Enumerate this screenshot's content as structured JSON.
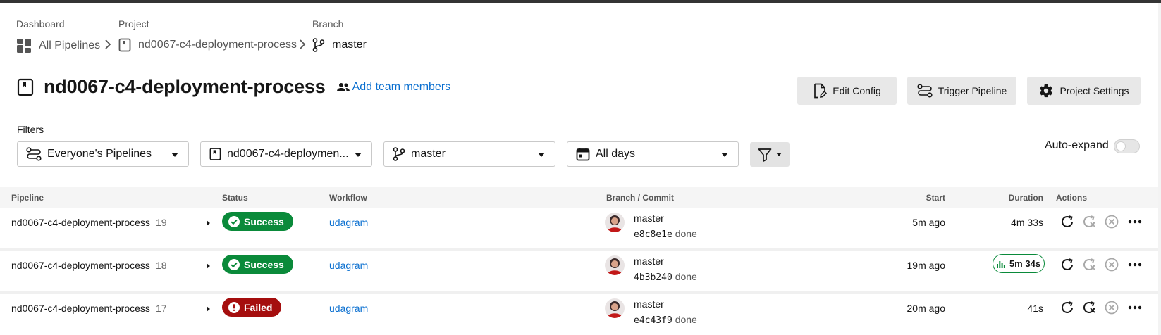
{
  "breadcrumb": {
    "dashboard": {
      "title": "Dashboard",
      "label": "All Pipelines"
    },
    "project": {
      "title": "Project",
      "label": "nd0067-c4-deployment-process"
    },
    "branch": {
      "title": "Branch",
      "label": "master"
    }
  },
  "header": {
    "title": "nd0067-c4-deployment-process",
    "add_team_label": "Add team members",
    "buttons": {
      "edit_config": "Edit Config",
      "trigger_pipeline": "Trigger Pipeline",
      "project_settings": "Project Settings"
    }
  },
  "filters": {
    "label": "Filters",
    "pipelines": "Everyone's Pipelines",
    "project": "nd0067-c4-deploymen...",
    "branch": "master",
    "date": "All days",
    "auto_expand_label": "Auto-expand",
    "auto_expand_on": false
  },
  "table": {
    "headers": {
      "pipeline": "Pipeline",
      "status": "Status",
      "workflow": "Workflow",
      "branch_commit": "Branch / Commit",
      "start": "Start",
      "duration": "Duration",
      "actions": "Actions"
    },
    "rows": [
      {
        "name": "nd0067-c4-deployment-process",
        "number": "19",
        "status": "Success",
        "workflow": "udagram",
        "branch": "master",
        "commit": "e8c8e1e",
        "commit_msg": "done",
        "start": "5m ago",
        "duration": "4m 33s"
      },
      {
        "name": "nd0067-c4-deployment-process",
        "number": "18",
        "status": "Success",
        "workflow": "udagram",
        "branch": "master",
        "commit": "4b3b240",
        "commit_msg": "done",
        "start": "19m ago",
        "duration": "5m 34s"
      },
      {
        "name": "nd0067-c4-deployment-process",
        "number": "17",
        "status": "Failed",
        "workflow": "udagram",
        "branch": "master",
        "commit": "e4c43f9",
        "commit_msg": "done",
        "start": "20m ago",
        "duration": "41s"
      }
    ]
  },
  "colors": {
    "success": "#0a8a3a",
    "failed": "#a50e0e",
    "link": "#0a6fd0"
  },
  "icons": [
    "dashboard-icon",
    "project-icon",
    "branch-icon",
    "people-icon",
    "file-edit-icon",
    "pipeline-icon",
    "gear-icon",
    "calendar-icon",
    "funnel-icon",
    "check-circle-icon",
    "alert-circle-icon",
    "insights-icon",
    "rerun-icon",
    "rerun-failed-icon",
    "cancel-icon",
    "more-icon"
  ]
}
